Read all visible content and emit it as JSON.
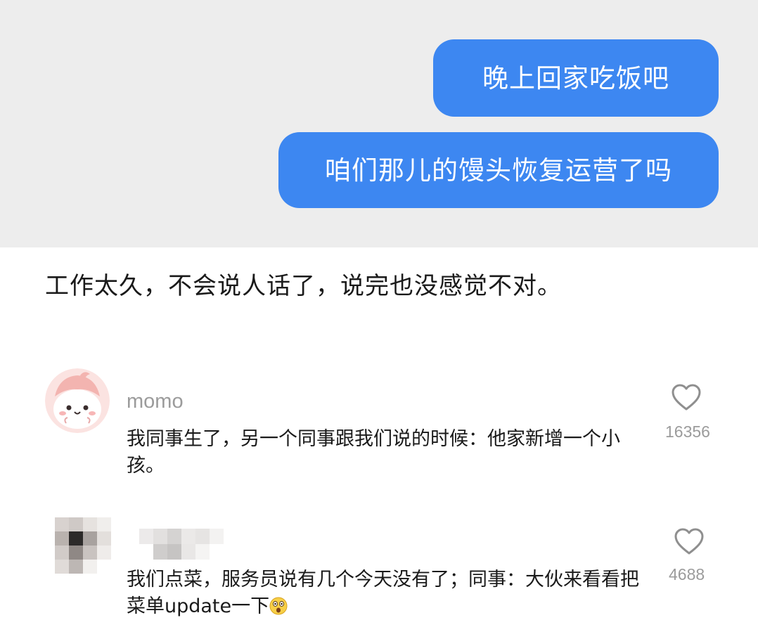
{
  "chat": {
    "messages": [
      {
        "text": "晚上回家吃饭吧",
        "color": "#3d87f1"
      },
      {
        "text": "咱们那儿的馒头恢复运营了吗",
        "color": "#3d87f1"
      }
    ]
  },
  "caption": "工作太久，不会说人话了，说完也没感觉不对。",
  "comments": [
    {
      "username": "momo",
      "text": "我同事生了，另一个同事跟我们说的时候：他家新增一个小孩。",
      "likes": "16356",
      "avatar_icon": "cartoon-face-avatar"
    },
    {
      "username": "",
      "text_main": "我们点菜，服务员说有几个今天没有了；同事：大伙来看看把菜单update一下",
      "emoji_icon": "astonished-face-emoji",
      "likes": "4688",
      "avatar_icon": "pixelated-avatar"
    }
  ],
  "colors": {
    "chat_background": "#ededed",
    "bubble": "#3d87f1",
    "muted_text": "#9b9b9b",
    "body_text": "#1a1a1a"
  }
}
